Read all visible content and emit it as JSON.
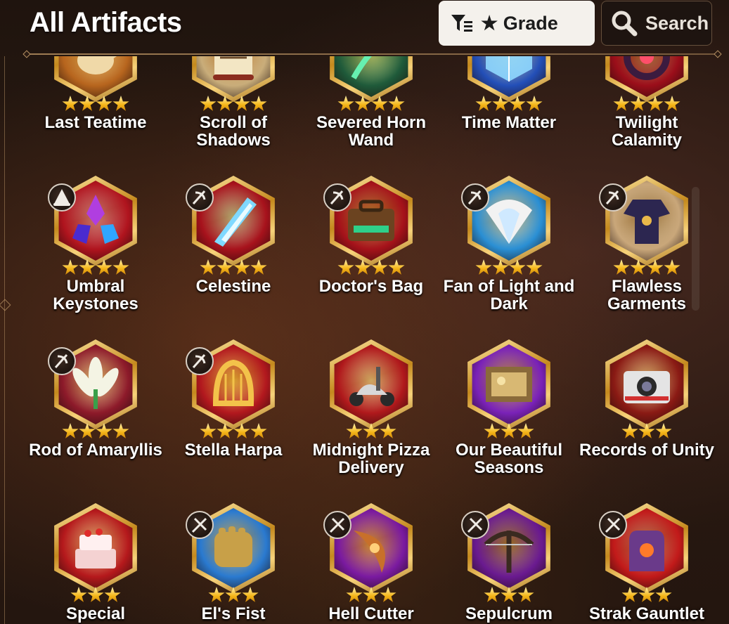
{
  "header": {
    "title": "All Artifacts",
    "filter_label": "★ Grade",
    "search_label": "Search"
  },
  "artifacts": [
    {
      "name": "Last Teatime",
      "stars": 4,
      "badge": "",
      "bg": "#b7651e",
      "accent": "#f0d9a8",
      "icon": "teapot-icon"
    },
    {
      "name": "Scroll of\nShadows",
      "stars": 4,
      "badge": "",
      "bg": "#c9ad7a",
      "accent": "#8b2d1f",
      "icon": "scroll-icon"
    },
    {
      "name": "Severed Horn\nWand",
      "stars": 4,
      "badge": "",
      "bg": "#1f5a3a",
      "accent": "#66f0b0",
      "icon": "horn-wand-icon"
    },
    {
      "name": "Time Matter",
      "stars": 4,
      "badge": "",
      "bg": "#234fb8",
      "accent": "#8fd8ff",
      "icon": "cube-icon"
    },
    {
      "name": "Twilight\nCalamity",
      "stars": 4,
      "badge": "",
      "bg": "#9b0e1a",
      "accent": "#3b1b3f",
      "icon": "ring-icon"
    },
    {
      "name": "Umbral\nKeystones",
      "stars": 4,
      "badge": "mage",
      "bg": "#b0141e",
      "accent": "#b03ee0",
      "icon": "crystal-icon"
    },
    {
      "name": "Celestine",
      "stars": 4,
      "badge": "thief",
      "bg": "#a7121c",
      "accent": "#7fd9ff",
      "icon": "blade-icon"
    },
    {
      "name": "Doctor's Bag",
      "stars": 4,
      "badge": "thief",
      "bg": "#a5121a",
      "accent": "#6b4320",
      "icon": "bag-icon"
    },
    {
      "name": "Fan of Light and\nDark",
      "stars": 4,
      "badge": "thief",
      "bg": "#2a8fd4",
      "accent": "#f2f2f2",
      "icon": "fan-icon"
    },
    {
      "name": "Flawless\nGarments",
      "stars": 4,
      "badge": "thief",
      "bg": "#c9a77a",
      "accent": "#2c2650",
      "icon": "garment-icon"
    },
    {
      "name": "Rod of Amaryllis",
      "stars": 4,
      "badge": "thief",
      "bg": "#8d1a2a",
      "accent": "#f4f4e4",
      "icon": "flower-icon"
    },
    {
      "name": "Stella Harpa",
      "stars": 4,
      "badge": "thief",
      "bg": "#b2181e",
      "accent": "#f3c24a",
      "icon": "harp-icon"
    },
    {
      "name": "Midnight Pizza\nDelivery",
      "stars": 3,
      "badge": "",
      "bg": "#b0191c",
      "accent": "#d8d8d8",
      "icon": "scooter-icon"
    },
    {
      "name": "Our Beautiful\nSeasons",
      "stars": 3,
      "badge": "",
      "bg": "#7a22b8",
      "accent": "#8a6a3a",
      "icon": "picture-frame-icon"
    },
    {
      "name": "Records of Unity",
      "stars": 3,
      "badge": "",
      "bg": "#8a1a14",
      "accent": "#e4e4e4",
      "icon": "camera-icon"
    },
    {
      "name": "Special",
      "stars": 3,
      "badge": "",
      "bg": "#b5191c",
      "accent": "#f4d2d2",
      "icon": "cake-icon"
    },
    {
      "name": "El's Fist",
      "stars": 3,
      "badge": "warrior",
      "bg": "#2a7ad0",
      "accent": "#c8a048",
      "icon": "fist-icon"
    },
    {
      "name": "Hell Cutter",
      "stars": 3,
      "badge": "warrior",
      "bg": "#7a1aa0",
      "accent": "#c8702a",
      "icon": "sword-icon"
    },
    {
      "name": "Sepulcrum",
      "stars": 3,
      "badge": "warrior",
      "bg": "#6a1a90",
      "accent": "#3a2a20",
      "icon": "crossbow-icon"
    },
    {
      "name": "Strak Gauntlet",
      "stars": 3,
      "badge": "warrior",
      "bg": "#c21a1a",
      "accent": "#6a3a8a",
      "icon": "gauntlet-icon"
    }
  ]
}
